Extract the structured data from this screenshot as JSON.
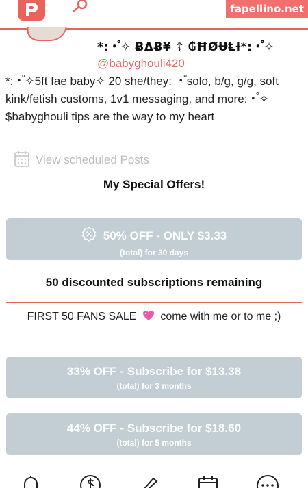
{
  "header": {
    "watermark": "fapellino.net",
    "logo_icon": "p-logo-icon",
    "search_icon": "magnifier-icon",
    "brand_color": "#e8635a"
  },
  "profile": {
    "display_name": "*:・゚✧ ɃΔɃ¥ ☦ ₲ĦØɄⱠƗ*:・゚✧",
    "handle": "@babyghouli420",
    "bio": "*:・゚✧5ft fae baby✧ 20 she/they: ・゚solo, b/g, g/g, soft kink/fetish customs, 1v1 messaging, and more:・゚✧ $babyghouli tips are the way to my heart",
    "scheduled_label": "View scheduled Posts"
  },
  "offers": {
    "title": "My Special Offers!",
    "primary": {
      "label": "50% OFF - ONLY $3.33",
      "sub": "(total) for 30 days"
    },
    "remaining": "50 discounted subscriptions remaining",
    "sale_text_before": "FIRST 50 FANS SALE",
    "sale_text_after": "come with me or to me ;)",
    "bundles": [
      {
        "label": "33% OFF  - Subscribe for $13.38",
        "sub": "(total) for 3 months"
      },
      {
        "label": "44% OFF  - Subscribe for $18.60",
        "sub": "(total) for 5 months"
      }
    ],
    "button_color": "#c2cdd4"
  },
  "bottom_nav": {
    "icons": [
      "bell-icon",
      "dollar-icon",
      "pencil-icon",
      "calendar-icon",
      "more-icon"
    ]
  }
}
